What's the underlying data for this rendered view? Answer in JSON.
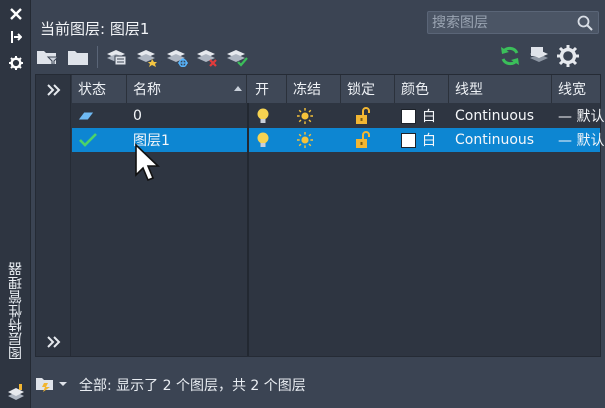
{
  "sidebar": {
    "title": "图层特性管理器",
    "tools": [
      "close-icon",
      "pin-icon",
      "settings-icon",
      "layer-stack-icon"
    ]
  },
  "header": {
    "current_layer_label": "当前图层: 图层1"
  },
  "search": {
    "placeholder": "搜索图层",
    "icon": "search-icon"
  },
  "toolbar": {
    "left_tools": [
      "new-property-filter-icon",
      "new-group-filter-icon",
      "layer-states-manager-icon",
      "new-layer-icon",
      "new-layer-vp-frozen-icon",
      "delete-layer-icon",
      "set-current-icon"
    ],
    "right_tools": [
      "refresh-icon",
      "layer-settings-icon",
      "gear-icon"
    ],
    "colors": {
      "refresh": "#3bbf5a"
    }
  },
  "grid": {
    "columns": [
      "状态",
      "名称",
      "开",
      "冻结",
      "锁定",
      "颜色",
      "线型",
      "线宽"
    ],
    "sorted_column": "名称",
    "rows": [
      {
        "status": "layer-icon",
        "name": "0",
        "on": "bulb-on-icon",
        "freeze": "sun-icon",
        "lock": "unlock-icon",
        "color_name": "白",
        "color": "#ffffff",
        "linetype": "Continuous",
        "lineweight": "— 默认",
        "selected": false
      },
      {
        "status": "current-check-icon",
        "name": "图层1",
        "on": "bulb-on-icon",
        "freeze": "sun-icon",
        "lock": "unlock-icon",
        "color_name": "白",
        "color": "#ffffff",
        "linetype": "Continuous",
        "lineweight": "— 默认",
        "selected": true
      }
    ],
    "selection_color": "#0d86d2"
  },
  "status_bar": {
    "text": "全部: 显示了 2 个图层，共 2 个图层"
  }
}
